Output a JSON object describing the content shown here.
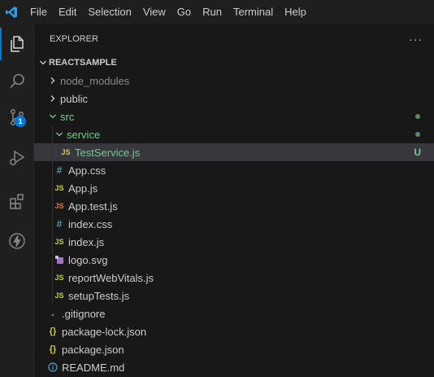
{
  "menubar": {
    "items": [
      "File",
      "Edit",
      "Selection",
      "View",
      "Go",
      "Run",
      "Terminal",
      "Help"
    ]
  },
  "activitybar": {
    "icons": [
      "explorer-icon",
      "search-icon",
      "source-control-icon",
      "run-debug-icon",
      "extensions-icon",
      "thunder-client-icon"
    ],
    "source_control_badge": "1",
    "accent_color": "#0078d4"
  },
  "explorer": {
    "title": "EXPLORER",
    "more_actions": "···",
    "project": "REACTSAMPLE",
    "items": [
      {
        "label": "node_modules",
        "kind": "folder",
        "expanded": false,
        "status": ""
      },
      {
        "label": "public",
        "kind": "folder",
        "expanded": false,
        "status": ""
      },
      {
        "label": "src",
        "kind": "folder",
        "expanded": true,
        "status": "dot"
      },
      {
        "label": "service",
        "kind": "folder",
        "expanded": true,
        "status": "dot"
      },
      {
        "label": "TestService.js",
        "kind": "js",
        "status": "U"
      },
      {
        "label": "App.css",
        "kind": "css",
        "status": ""
      },
      {
        "label": "App.js",
        "kind": "js",
        "status": ""
      },
      {
        "label": "App.test.js",
        "kind": "test-js",
        "status": ""
      },
      {
        "label": "index.css",
        "kind": "css",
        "status": ""
      },
      {
        "label": "index.js",
        "kind": "js",
        "status": ""
      },
      {
        "label": "logo.svg",
        "kind": "svg",
        "status": ""
      },
      {
        "label": "reportWebVitals.js",
        "kind": "js",
        "status": ""
      },
      {
        "label": "setupTests.js",
        "kind": "js",
        "status": ""
      },
      {
        "label": ".gitignore",
        "kind": "git",
        "status": ""
      },
      {
        "label": "package-lock.json",
        "kind": "json",
        "status": ""
      },
      {
        "label": "package.json",
        "kind": "json",
        "status": ""
      },
      {
        "label": "README.md",
        "kind": "md",
        "status": ""
      }
    ]
  },
  "colors": {
    "untracked": "#73c991",
    "js_icon": "#cbcb41",
    "css_icon": "#519aba",
    "test_icon": "#e37933",
    "json_icon": "#cbcb41",
    "svg_icon": "#a074c4"
  }
}
